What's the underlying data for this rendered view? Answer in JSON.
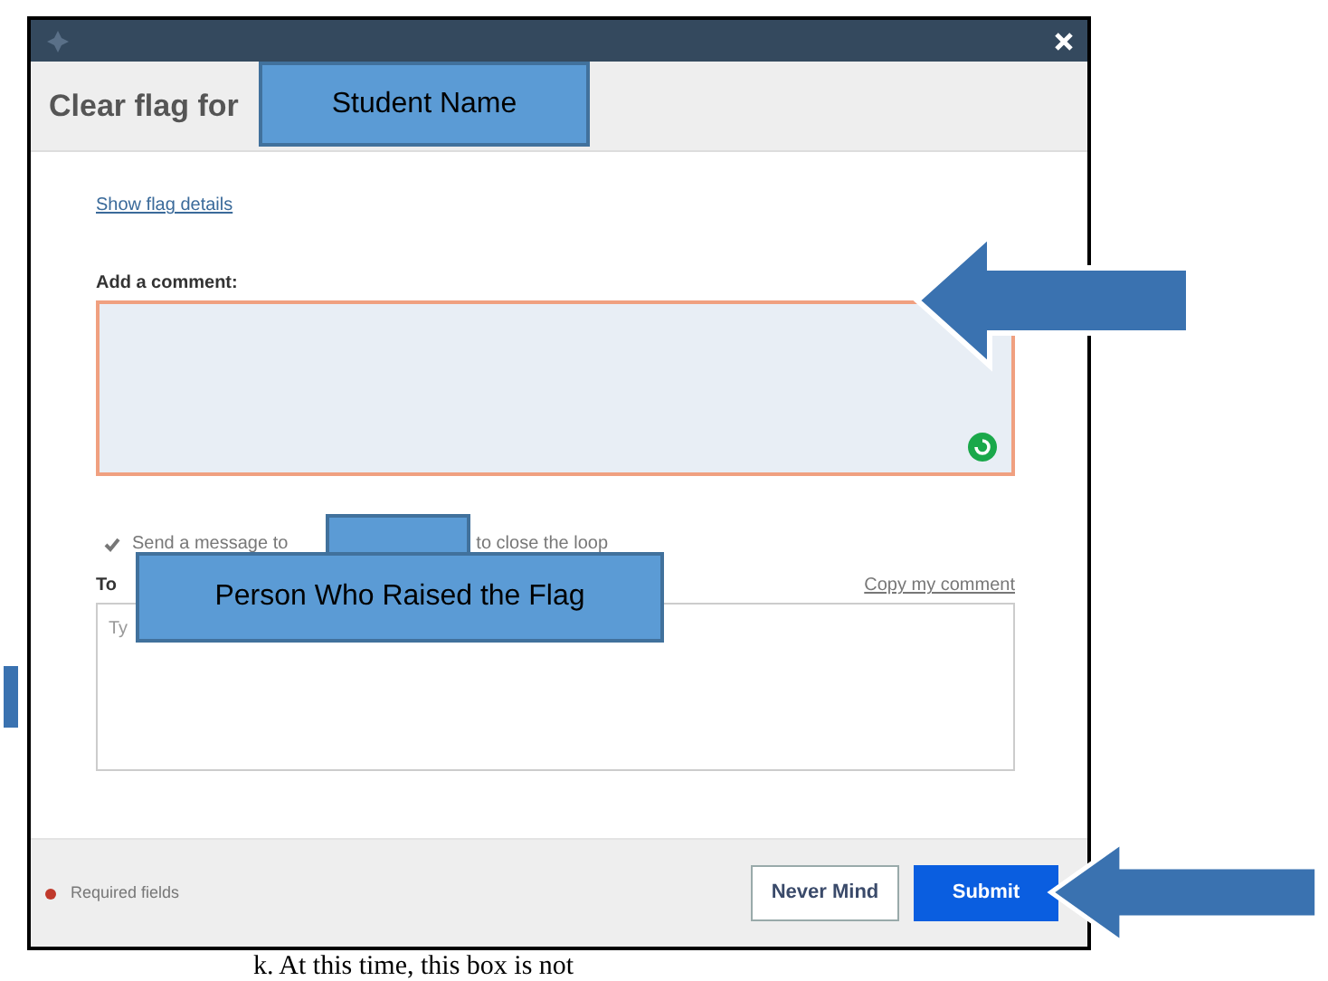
{
  "dialog": {
    "header_title": "Clear flag for",
    "show_details_link": "Show flag details",
    "comment_label": "Add a comment:",
    "send_message": {
      "checked": true,
      "label_before": "Send a message to",
      "label_after": "to close the loop"
    },
    "to_label": "To",
    "copy_link": "Copy my comment",
    "message_placeholder": "Ty",
    "required_note": "Required fields",
    "buttons": [
      {
        "label": "Never Mind",
        "kind": "secondary"
      },
      {
        "label": "Submit",
        "kind": "primary"
      }
    ]
  },
  "annotations": [
    {
      "kind": "label",
      "text": "Student Name"
    },
    {
      "kind": "redaction"
    },
    {
      "kind": "label",
      "text": "Person Who Raised the Flag"
    },
    {
      "kind": "arrow"
    },
    {
      "kind": "arrow"
    },
    {
      "kind": "edge"
    }
  ],
  "caption": "k.  At this time, this box is not"
}
